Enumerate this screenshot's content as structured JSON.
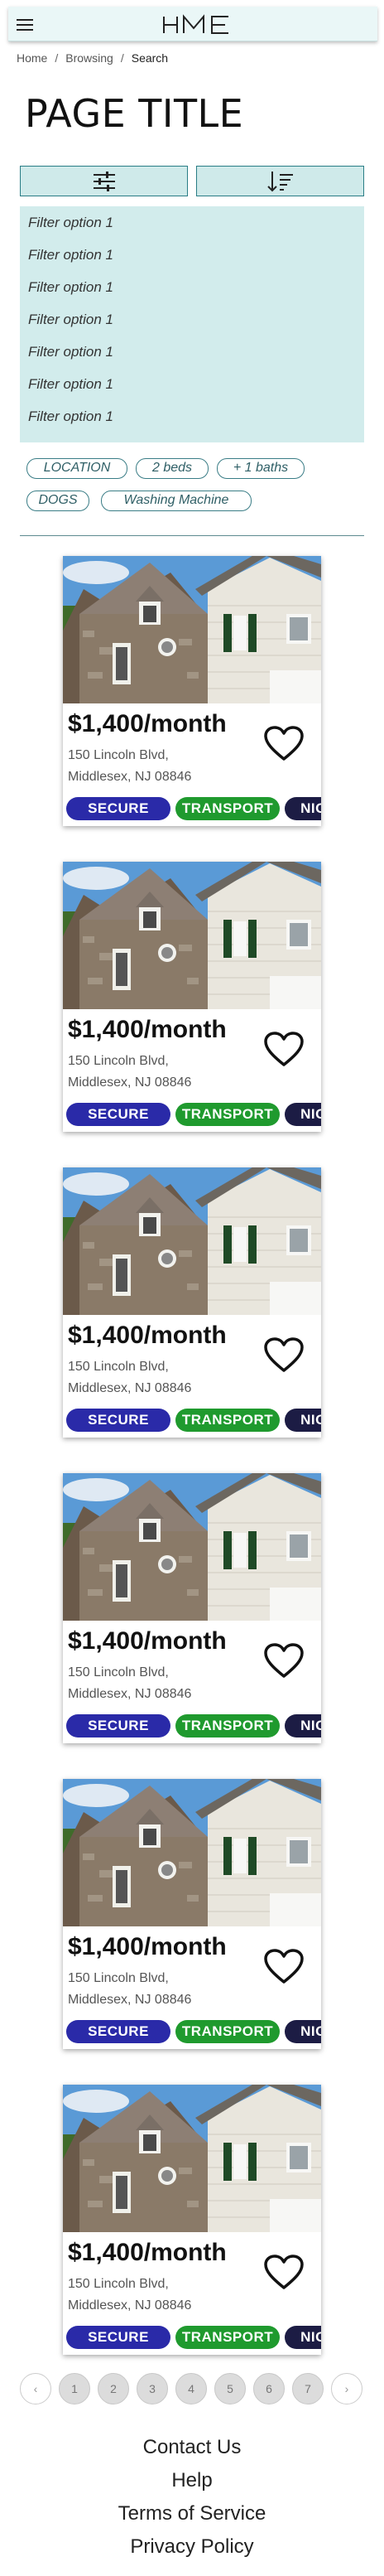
{
  "header": {
    "logo_text": "HME"
  },
  "breadcrumb": [
    "Home",
    "Browsing",
    "Search"
  ],
  "page_title": "PAGE TITLE",
  "toolbar": {
    "filter_icon": "sliders-icon",
    "sort_icon": "sort-descending-icon"
  },
  "filters": {
    "options": [
      "Filter option 1",
      "Filter option 1",
      "Filter option 1",
      "Filter option 1",
      "Filter option 1",
      "Filter option 1",
      "Filter option 1"
    ]
  },
  "chips": [
    "LOCATION",
    "2 beds",
    "+ 1 baths",
    "DOGS",
    "Washing Machine"
  ],
  "listings": [
    {
      "price": "$1,400/month",
      "address_line1": "150 Lincoln Blvd,",
      "address_line2": "Middlesex, NJ 08846",
      "tags": [
        "SECURE",
        "TRANSPORT",
        "NIG"
      ]
    },
    {
      "price": "$1,400/month",
      "address_line1": "150 Lincoln Blvd,",
      "address_line2": "Middlesex, NJ 08846",
      "tags": [
        "SECURE",
        "TRANSPORT",
        "NIG"
      ]
    },
    {
      "price": "$1,400/month",
      "address_line1": "150 Lincoln Blvd,",
      "address_line2": "Middlesex, NJ 08846",
      "tags": [
        "SECURE",
        "TRANSPORT",
        "NIG"
      ]
    },
    {
      "price": "$1,400/month",
      "address_line1": "150 Lincoln Blvd,",
      "address_line2": "Middlesex, NJ 08846",
      "tags": [
        "SECURE",
        "TRANSPORT",
        "NIG"
      ]
    },
    {
      "price": "$1,400/month",
      "address_line1": "150 Lincoln Blvd,",
      "address_line2": "Middlesex, NJ 08846",
      "tags": [
        "SECURE",
        "TRANSPORT",
        "NIG"
      ]
    },
    {
      "price": "$1,400/month",
      "address_line1": "150 Lincoln Blvd,",
      "address_line2": "Middlesex, NJ 08846",
      "tags": [
        "SECURE",
        "TRANSPORT",
        "NIG"
      ]
    }
  ],
  "tag_colors": {
    "SECURE": "#2a2aa8",
    "TRANSPORT": "#1f9a2e",
    "NIG": "#1c1c44"
  },
  "pagination": {
    "prev": "‹",
    "next": "›",
    "pages": [
      "1",
      "2",
      "3",
      "4",
      "5",
      "6",
      "7"
    ]
  },
  "footer": {
    "links": [
      "Contact Us",
      "Help",
      "Terms of Service",
      "Privacy Policy"
    ]
  },
  "colors": {
    "header_bg": "#eaf7f7",
    "panel_bg": "#d2ecec",
    "accent": "#2a7d86"
  }
}
